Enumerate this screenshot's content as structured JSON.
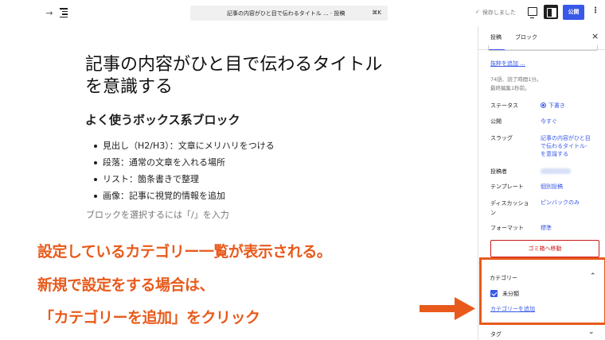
{
  "toolbar": {
    "undo": "→",
    "doc_title": "記事の内容がひと目で伝わるタイトル ... · 投稿",
    "shortcut": "⌘K",
    "saved_check": "✓",
    "saved": "保存しました",
    "publish": "公開",
    "more": "⋮"
  },
  "editor": {
    "title": "記事の内容がひと目で伝わるタイトル を意識する",
    "heading": "よく使うボックス系ブロック",
    "list": [
      "見出し（H2/H3）：文章にメリハリをつける",
      "段落：通常の文章を入れる場所",
      "リスト：箇条書きで整理",
      "画像：記事に視覚的情報を追加"
    ],
    "placeholder": "ブロックを選択するには「/」を入力"
  },
  "sidebar": {
    "tabs": {
      "post": "投稿",
      "block": "ブロック"
    },
    "close": "×",
    "add_excerpt": "抜粋を追加 ...",
    "stats_line1": "74語、読了時間1分。",
    "stats_line2": "最終編集1秒前。",
    "meta": {
      "status_label": "ステータス",
      "status_value": "下書き",
      "publish_label": "公開",
      "publish_value": "今すぐ",
      "slug_label": "スラッグ",
      "slug_line1": "記事の内容がひと目",
      "slug_line2": "で伝わるタイトル-",
      "slug_line3": "を意識する",
      "author_label": "投稿者",
      "template_label": "テンプレート",
      "template_value": "個別投稿",
      "discussion_label_1": "ディスカッショ",
      "discussion_label_2": "ン",
      "discussion_value": "ピンバックのみ",
      "format_label": "フォーマット",
      "format_value": "標準"
    },
    "trash": "ゴミ箱へ移動",
    "categories": {
      "header": "カテゴリー",
      "chevron": "⌃",
      "items": [
        {
          "label": "未分類",
          "checked": true
        }
      ],
      "add_link": "カテゴリーを追加"
    },
    "tags": {
      "header": "タグ",
      "chevron": "⌄"
    }
  },
  "annotation": {
    "line1": "設定しているカテゴリー一覧が表示される。",
    "line2": "新規で設定をする場合は、",
    "line3": "「カテゴリーを追加」をクリック",
    "color": "#e85a1b"
  },
  "colors": {
    "accent": "#3858e9",
    "danger": "#cc1818",
    "annotation": "#e85a1b"
  }
}
